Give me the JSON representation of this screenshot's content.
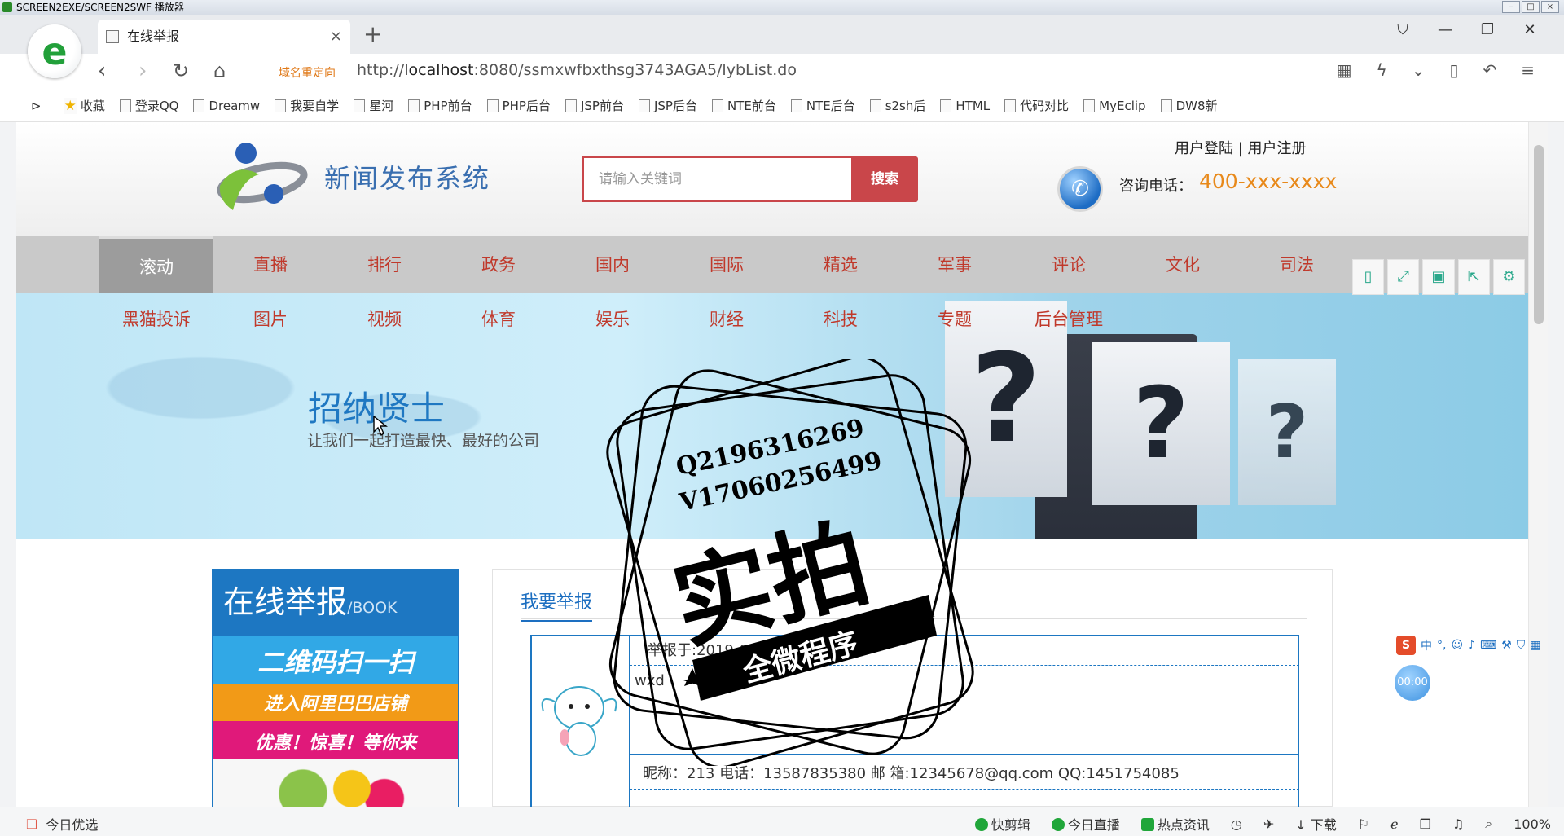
{
  "player": {
    "title": "SCREEN2EXE/SCREEN2SWF 播放器"
  },
  "browser": {
    "tab_title": "在线举报",
    "redirect_label": "域名重定向",
    "url_prefix": "http://",
    "url_host": "localhost",
    "url_rest": ":8080/ssmxwfbxthsg3743AGA5/lybList.do",
    "bookmarks": [
      "收藏",
      "登录QQ",
      "Dreamw",
      "我要自学",
      "星河",
      "PHP前台",
      "PHP后台",
      "JSP前台",
      "JSP后台",
      "NTE前台",
      "NTE后台",
      "s2sh后",
      "HTML",
      "代码对比",
      "MyEclip",
      "DW8新"
    ]
  },
  "site": {
    "name": "新闻发布系统",
    "search_placeholder": "请输入关键词",
    "search_button": "搜索",
    "login": "用户登陆",
    "separator": "|",
    "register": "用户注册",
    "phone_label": "咨询电话：",
    "phone_number": "400-xxx-xxxx",
    "categories": [
      "滚动",
      "直播",
      "排行",
      "政务",
      "国内",
      "国际",
      "精选",
      "军事",
      "评论",
      "文化",
      "司法"
    ],
    "subcategories": [
      "黑猫投诉",
      "图片",
      "视频",
      "体育",
      "娱乐",
      "财经",
      "科技",
      "专题",
      "后台管理"
    ],
    "banner_title": "招纳贤士",
    "banner_subtitle": "让我们一起打造最快、最好的公司",
    "banner_paper_glyph": "?"
  },
  "sidebar": {
    "title": "在线举报",
    "title_suffix": "/BOOK",
    "ad_lines": [
      "二维码扫一扫",
      "进入阿里巴巴店铺",
      "优惠！惊喜！等你来"
    ]
  },
  "content": {
    "tab": "我要举报",
    "entry": {
      "time": "举报于:2019-02-19 00:34:41.0",
      "body": "wxd",
      "meta": "昵称：213    电话：13587835380  邮 箱:12345678@qq.com    QQ:1451754085"
    }
  },
  "watermark": {
    "line1": "Q2196316269",
    "line2": "V17060256499",
    "main": "实拍",
    "banner": "全微程序"
  },
  "ime": {
    "label": "中"
  },
  "timer": "00:00",
  "status": {
    "left": "今日优选",
    "items": [
      "快剪辑",
      "今日直播",
      "热点资讯",
      "下载"
    ],
    "zoom": "100%"
  }
}
